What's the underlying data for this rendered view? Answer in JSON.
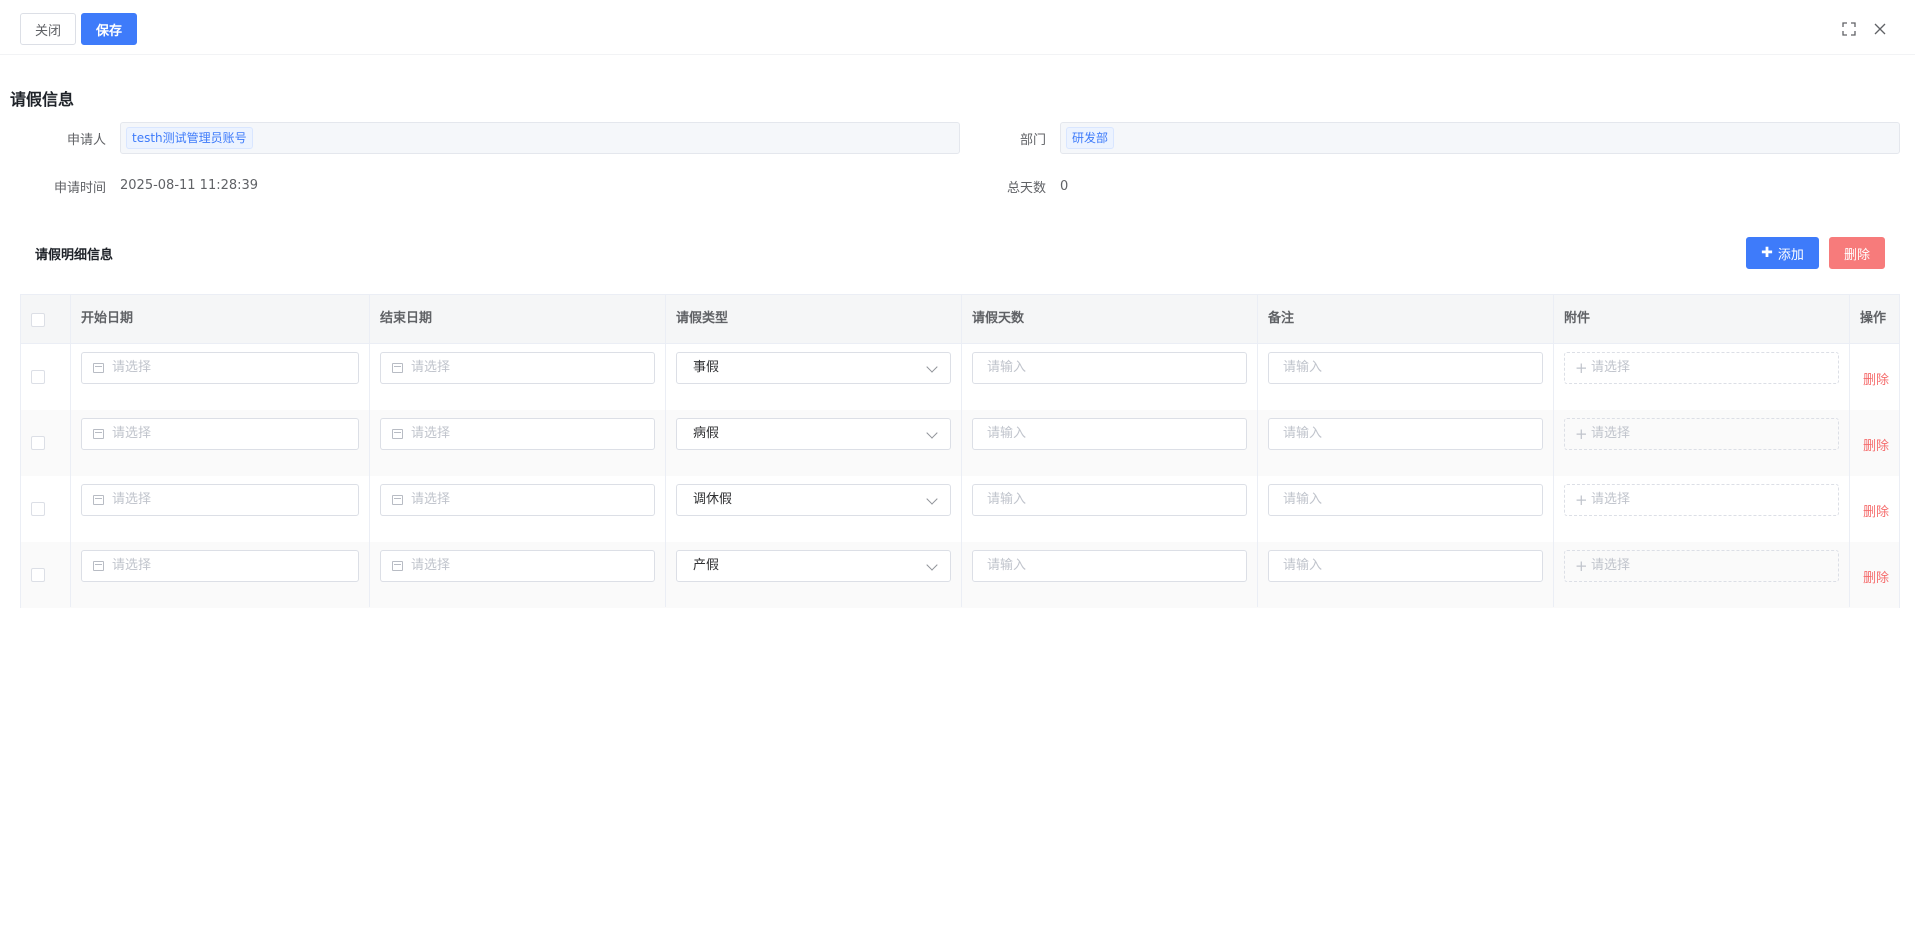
{
  "toolbar": {
    "close_label": "关闭",
    "save_label": "保存"
  },
  "window_icons": [
    "fullscreen-icon",
    "close-icon"
  ],
  "form": {
    "section_title": "请假信息",
    "applicant_label": "申请人",
    "applicant_value": "testh测试管理员账号",
    "department_label": "部门",
    "department_value": "研发部",
    "apply_time_label": "申请时间",
    "apply_time_value": "2025-08-11 11:28:39",
    "total_days_label": "总天数",
    "total_days_value": "0"
  },
  "detail": {
    "title": "请假明细信息",
    "add_label": "添加",
    "delete_label": "删除"
  },
  "table": {
    "columns": [
      "开始日期",
      "结束日期",
      "请假类型",
      "请假天数",
      "备注",
      "附件",
      "操作"
    ],
    "rows": [
      {
        "start_placeholder": "请选择",
        "end_placeholder": "请选择",
        "leave_type": "事假",
        "days_placeholder": "请输入",
        "remark_placeholder": "请输入",
        "attachment_placeholder": "请选择",
        "action": "删除"
      },
      {
        "start_placeholder": "请选择",
        "end_placeholder": "请选择",
        "leave_type": "病假",
        "days_placeholder": "请输入",
        "remark_placeholder": "请输入",
        "attachment_placeholder": "请选择",
        "action": "删除"
      },
      {
        "start_placeholder": "请选择",
        "end_placeholder": "请选择",
        "leave_type": "调休假",
        "days_placeholder": "请输入",
        "remark_placeholder": "请输入",
        "attachment_placeholder": "请选择",
        "action": "删除"
      },
      {
        "start_placeholder": "请选择",
        "end_placeholder": "请选择",
        "leave_type": "产假",
        "days_placeholder": "请输入",
        "remark_placeholder": "请输入",
        "attachment_placeholder": "请选择",
        "action": "删除"
      }
    ]
  },
  "colors": {
    "primary": "#3e7bfa",
    "danger": "#f77b7b",
    "danger_text": "#f56c6c"
  }
}
